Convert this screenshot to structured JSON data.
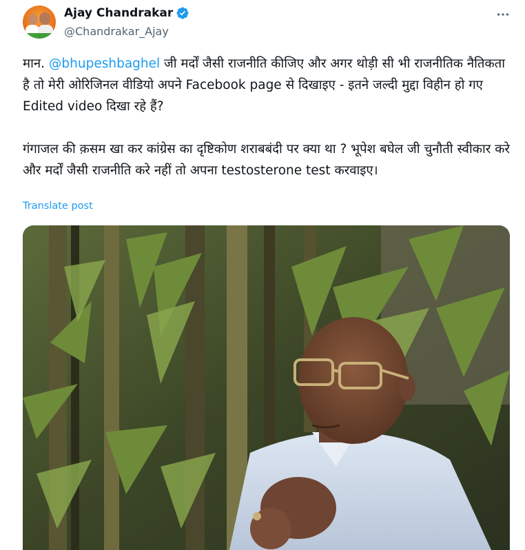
{
  "author": {
    "display_name": "Ajay Chandrakar",
    "handle": "@Chandrakar_Ajay",
    "verified": true,
    "avatar_icon": "profile-photo",
    "verified_icon": "verified-badge-icon"
  },
  "tweet": {
    "para1": {
      "prefix": "मान. ",
      "mention": "@bhupeshbaghel",
      "suffix": " जी मर्दों जैसी राजनीति कीजिए और अगर थोड़ी सी भी राजनीतिक नैतिकता है तो मेरी ओरिजिनल वीडियो अपने  Facebook page से दिखाइए - इतने जल्दी मुद्दा विहीन हो गए Edited video दिखा रहे हैं?"
    },
    "para2": "गंगाजल की क़सम खा कर कांग्रेस का दृष्टिकोण शराबबंदी पर क्या था ? भूपेश बघेल जी चुनौती स्वीकार करे और मर्दों जैसी राजनीति करे नहीं तो अपना testosterone test करवाइए।",
    "translate_label": "Translate post"
  },
  "media": {
    "type": "video-still",
    "alt_description_icon": "video-frame"
  },
  "colors": {
    "accent": "#1d9bf0",
    "text": "#0f1419",
    "secondary": "#536471"
  }
}
